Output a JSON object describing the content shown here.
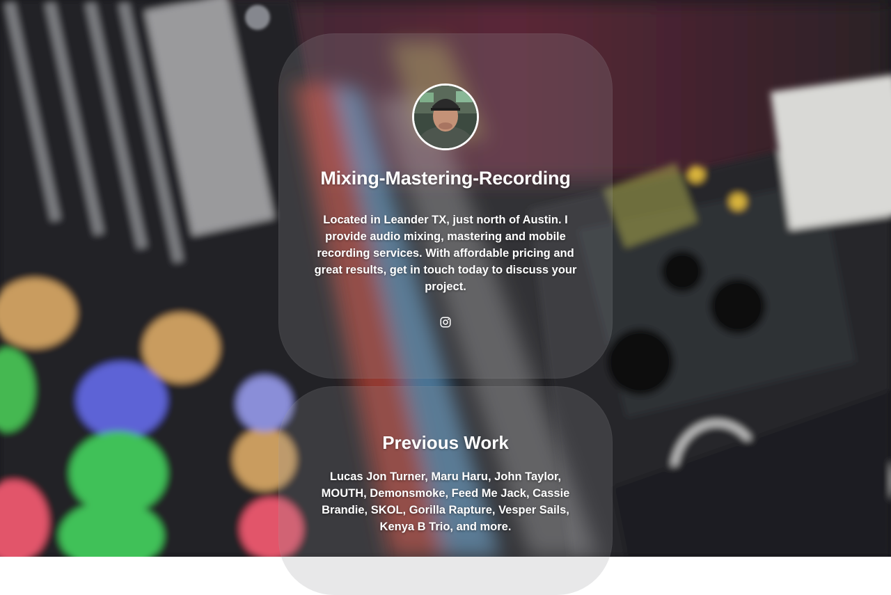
{
  "profile": {
    "avatar_alt": "profile-photo",
    "title": "Mixing-Mastering-Recording",
    "bio": "Located in Leander TX, just north of Austin. I provide audio mixing, mastering and mobile recording services. With affordable pricing and great results, get in touch today to discuss your project.",
    "social": {
      "icon": "instagram-icon"
    }
  },
  "previous_work": {
    "title": "Previous Work",
    "text": "Lucas Jon Turner, Maru Haru, John Taylor, MOUTH, Demonsmoke, Feed Me Jack, Cassie Brandie, SKOL, Gorilla Rapture, Vesper Sails, Kenya B Trio, and more."
  },
  "colors": {
    "card_bg": "#96969b",
    "text": "#ffffff",
    "background": "#1a1a1e"
  }
}
